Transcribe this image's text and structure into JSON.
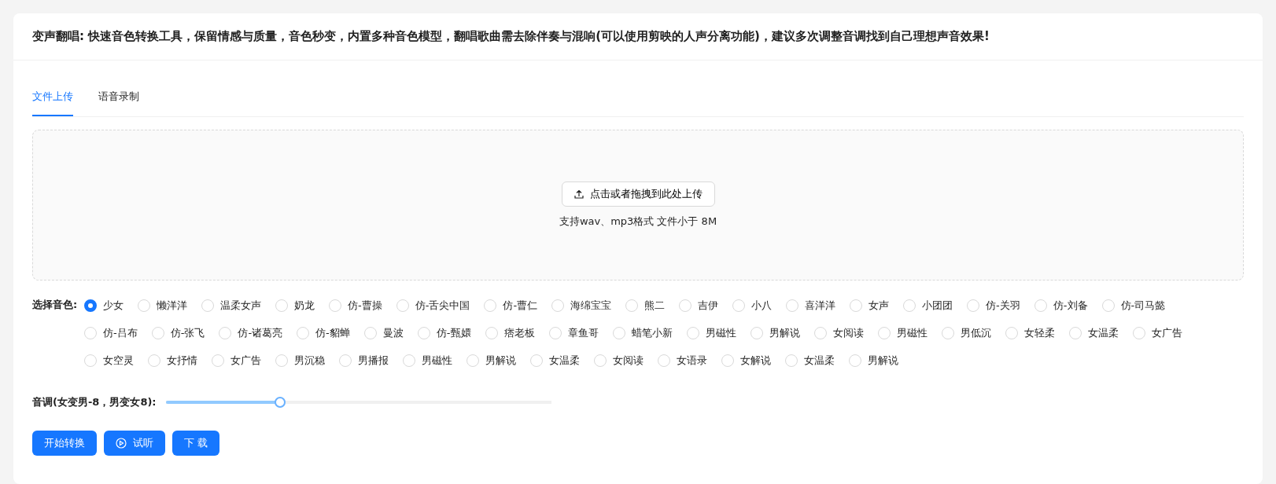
{
  "header": {
    "title": "变声翻唱: 快速音色转换工具，保留情感与质量，音色秒变，内置多种音色模型，翻唱歌曲需去除伴奏与混响(可以使用剪映的人声分离功能)，建议多次调整音调找到自己理想声音效果!"
  },
  "tabs": [
    {
      "label": "文件上传",
      "selected": true
    },
    {
      "label": "语音录制",
      "selected": false
    }
  ],
  "upload": {
    "button": "点击或者拖拽到此处上传",
    "hint": "支持wav、mp3格式 文件小于 8M"
  },
  "voice": {
    "label": "选择音色:",
    "rows": [
      [
        {
          "label": "少女",
          "selected": true
        },
        {
          "label": "懒洋洋",
          "selected": false
        },
        {
          "label": "温柔女声",
          "selected": false
        },
        {
          "label": "奶龙",
          "selected": false
        },
        {
          "label": "仿-曹操",
          "selected": false
        },
        {
          "label": "仿-舌尖中国",
          "selected": false
        },
        {
          "label": "仿-曹仁",
          "selected": false
        },
        {
          "label": "海绵宝宝",
          "selected": false
        },
        {
          "label": "熊二",
          "selected": false
        },
        {
          "label": "吉伊",
          "selected": false
        },
        {
          "label": "小八",
          "selected": false
        },
        {
          "label": "喜洋洋",
          "selected": false
        },
        {
          "label": "女声",
          "selected": false
        },
        {
          "label": "小团团",
          "selected": false
        },
        {
          "label": "仿-关羽",
          "selected": false
        },
        {
          "label": "仿-刘备",
          "selected": false
        },
        {
          "label": "仿-司马懿",
          "selected": false
        }
      ],
      [
        {
          "label": "仿-吕布",
          "selected": false
        },
        {
          "label": "仿-张飞",
          "selected": false
        },
        {
          "label": "仿-诸葛亮",
          "selected": false
        },
        {
          "label": "仿-貂蝉",
          "selected": false
        },
        {
          "label": "曼波",
          "selected": false
        },
        {
          "label": "仿-甄嬛",
          "selected": false
        },
        {
          "label": "痞老板",
          "selected": false
        },
        {
          "label": "章鱼哥",
          "selected": false
        },
        {
          "label": "蜡笔小新",
          "selected": false
        },
        {
          "label": "男磁性",
          "selected": false
        },
        {
          "label": "男解说",
          "selected": false
        },
        {
          "label": "女阅读",
          "selected": false
        },
        {
          "label": "男磁性",
          "selected": false
        },
        {
          "label": "男低沉",
          "selected": false
        },
        {
          "label": "女轻柔",
          "selected": false
        },
        {
          "label": "女温柔",
          "selected": false
        },
        {
          "label": "女广告",
          "selected": false
        }
      ],
      [
        {
          "label": "女空灵",
          "selected": false
        },
        {
          "label": "女抒情",
          "selected": false
        },
        {
          "label": "女广告",
          "selected": false
        },
        {
          "label": "男沉稳",
          "selected": false
        },
        {
          "label": "男播报",
          "selected": false
        },
        {
          "label": "男磁性",
          "selected": false
        },
        {
          "label": "男解说",
          "selected": false
        },
        {
          "label": "女温柔",
          "selected": false
        },
        {
          "label": "女阅读",
          "selected": false
        },
        {
          "label": "女语录",
          "selected": false
        },
        {
          "label": "女解说",
          "selected": false
        },
        {
          "label": "女温柔",
          "selected": false
        },
        {
          "label": "男解说",
          "selected": false
        }
      ]
    ]
  },
  "pitch": {
    "label": "音调(女变男-8，男变女8):",
    "level": 0.29
  },
  "buttons": [
    {
      "label": "开始转换",
      "kind": "plain"
    },
    {
      "label": "试听",
      "kind": "play"
    },
    {
      "label": "下 载",
      "kind": "plain"
    }
  ]
}
